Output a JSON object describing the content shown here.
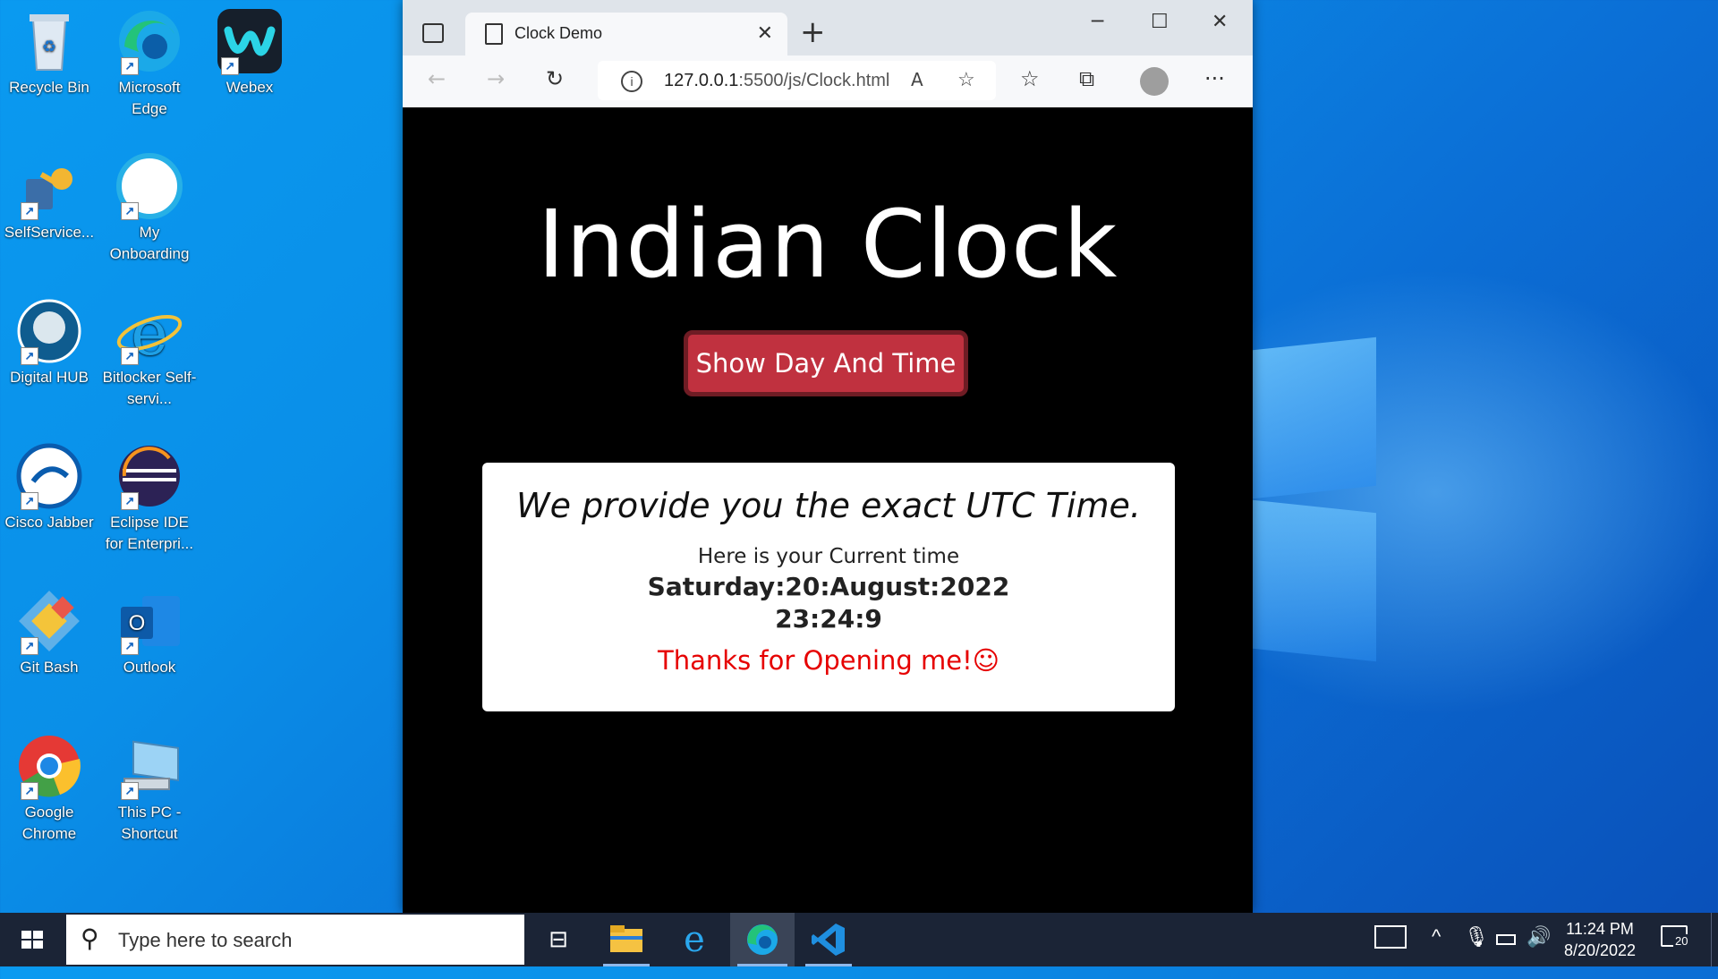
{
  "desktop": {
    "icons": [
      {
        "name": "Recycle Bin"
      },
      {
        "name": "Microsoft Edge"
      },
      {
        "name": "Webex"
      },
      {
        "name": "SelfService..."
      },
      {
        "name": "My Onboarding"
      },
      {
        "name": "Digital HUB"
      },
      {
        "name": "Bitlocker Self-servi..."
      },
      {
        "name": "Cisco Jabber"
      },
      {
        "name": "Eclipse IDE for Enterpri..."
      },
      {
        "name": "Git Bash"
      },
      {
        "name": "Outlook"
      },
      {
        "name": "Google Chrome"
      },
      {
        "name": "This PC - Shortcut"
      }
    ]
  },
  "browser": {
    "tab_title": "Clock Demo",
    "new_tab": "+",
    "url_host": "127.0.0.1",
    "url_path": ":5500/js/Clock.html",
    "controls": {
      "minimize": "─",
      "maximize": "☐",
      "close": "✕"
    }
  },
  "page": {
    "heading": "Indian Clock",
    "button_label": "Show Day And Time",
    "card": {
      "lead": "We provide you the exact UTC Time.",
      "sub": "Here is your Current time",
      "date": "Saturday:20:August:2022",
      "time": "23:24:9",
      "thanks": "Thanks for Opening me!☺"
    }
  },
  "taskbar": {
    "search_placeholder": "Type here to search",
    "clock_time": "11:24 PM",
    "clock_date": "8/20/2022",
    "notification_count": "20"
  }
}
